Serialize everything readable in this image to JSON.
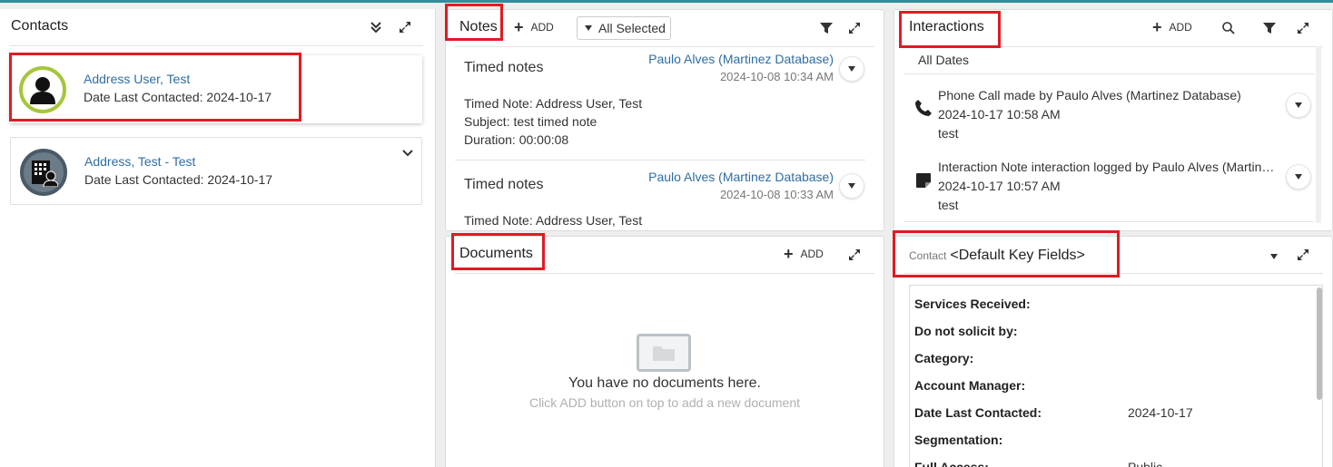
{
  "contacts": {
    "title": "Contacts",
    "items": [
      {
        "name": "Address User, Test",
        "date_line": "Date Last Contacted: 2024-10-17"
      },
      {
        "name": "Address, Test - Test",
        "date_line": "Date Last Contacted: 2024-10-17"
      }
    ]
  },
  "notes": {
    "title": "Notes",
    "add_label": "ADD",
    "filter_label": "All Selected",
    "items": [
      {
        "type": "Timed notes",
        "author": "Paulo Alves (Martinez Database)",
        "timestamp": "2024-10-08 10:34 AM",
        "line1": "Timed Note: Address User, Test",
        "line2": "Subject: test timed note",
        "line3": "Duration: 00:00:08"
      },
      {
        "type": "Timed notes",
        "author": "Paulo Alves (Martinez Database)",
        "timestamp": "2024-10-08 10:33 AM",
        "line1": "Timed Note: Address User, Test"
      }
    ]
  },
  "interactions": {
    "title": "Interactions",
    "add_label": "ADD",
    "date_filter": "All Dates",
    "items": [
      {
        "title": "Phone Call made by Paulo Alves (Martinez Database)",
        "timestamp": "2024-10-17 10:58 AM",
        "note": "test",
        "icon": "phone-icon"
      },
      {
        "title": "Interaction Note interaction logged by Paulo Alves (Martine…",
        "timestamp": "2024-10-17 10:57 AM",
        "note": "test",
        "icon": "note-icon"
      }
    ]
  },
  "documents": {
    "title": "Documents",
    "add_label": "ADD",
    "empty_title": "You have no documents here.",
    "empty_hint": "Click ADD button on top to add a new document"
  },
  "key_fields": {
    "prefix": "Contact",
    "title": "<Default Key Fields>",
    "rows": [
      {
        "label": "Services Received:",
        "value": ""
      },
      {
        "label": "Do not solicit by:",
        "value": ""
      },
      {
        "label": "Category:",
        "value": ""
      },
      {
        "label": "Account Manager:",
        "value": ""
      },
      {
        "label": "Date Last Contacted:",
        "value": "2024-10-17"
      },
      {
        "label": "Segmentation:",
        "value": ""
      },
      {
        "label": "Full Access:",
        "value": "Public"
      }
    ]
  },
  "colors": {
    "accent": "#2e6da4",
    "highlight": "#e21a22",
    "avatar_ring": "#a5c63b"
  }
}
